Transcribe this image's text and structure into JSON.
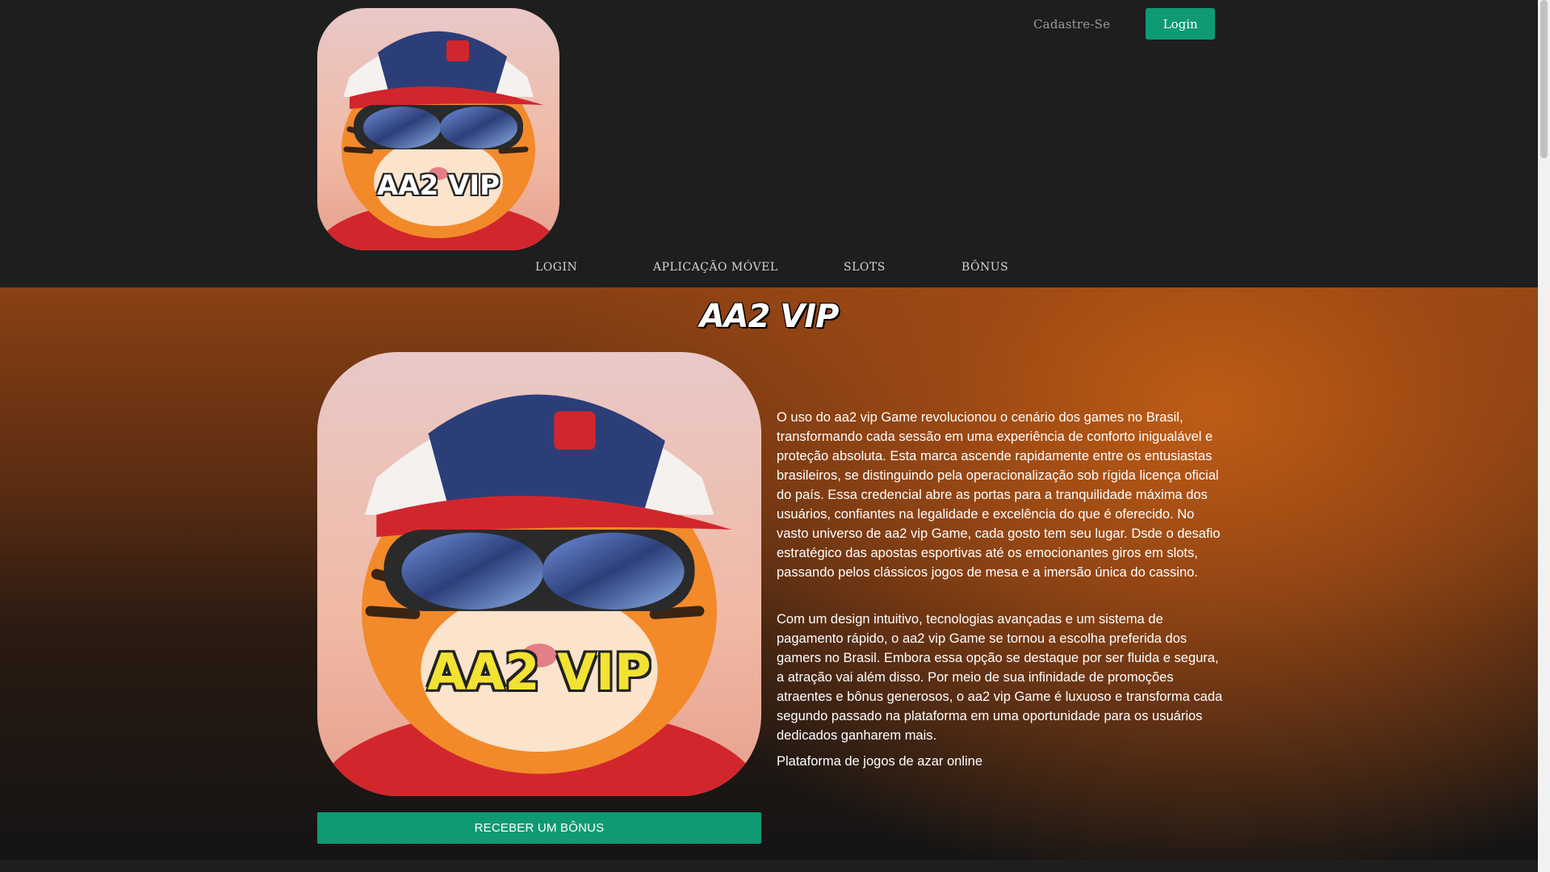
{
  "header": {
    "logo_alt": "AA2 VIP",
    "register_label": "Cadastre-Se",
    "login_label": "Login"
  },
  "nav": {
    "items": [
      {
        "label": "LOGIN"
      },
      {
        "label": "APLICAÇÃO MÓVEL"
      },
      {
        "label": "SLOTS"
      },
      {
        "label": "BÔNUS"
      }
    ]
  },
  "hero": {
    "title": "AA2 VIP",
    "image_text": "AA2 VIP",
    "paragraphs": [
      "O uso do aa2 vip Game revolucionou o cenário dos games no Brasil, transformando cada sessão em uma experiência de conforto inigualável e proteção absoluta. Esta marca ascende rapidamente entre os entusiastas brasileiros, se distinguindo pela operacionalização sob rígida licença oficial do país. Essa credencial abre as portas para a tranquilidade máxima dos usuários, confiantes na legalidade e excelência do que é oferecido. No vasto universo de aa2 vip Game, cada gosto tem seu lugar. Dsde o desafio estratégico das apostas esportivas até os emocionantes giros em slots, passando pelos clássicos jogos de mesa e a imersão única do cassino.",
      "Com um design intuitivo, tecnologias avançadas e um sistema de pagamento rápido, o aa2 vip Game se tornou a escolha preferida dos gamers no Brasil. Embora essa opção se destaque por ser fluida e segura, a atração vai além disso. Por meio de sua infinidade de promoções atraentes e bônus generosos, o aa2 vip Game é luxuoso e transforma cada segundo passado na plataforma em uma oportunidade para os usuários dedicados ganharem mais.",
      "Plataforma de jogos de azar online"
    ],
    "bonus_button": "RECEBER UM BÔNUS"
  },
  "colors": {
    "accent": "#0f9a74",
    "header_bg": "#1e1e1e",
    "hero_orange": "#be5c16"
  }
}
